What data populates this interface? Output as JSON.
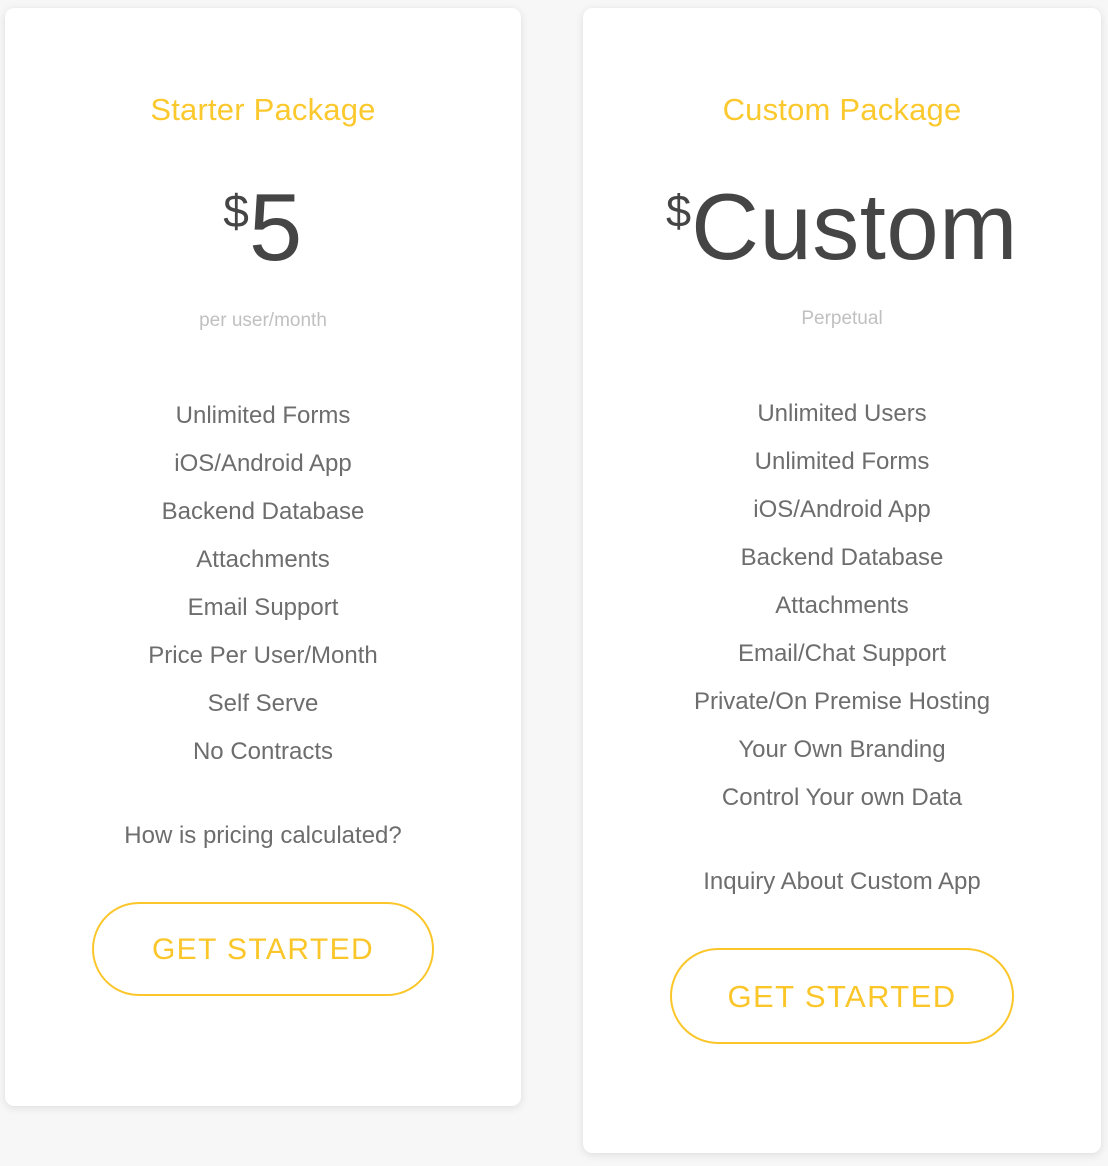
{
  "background_color": "#f7f7f7",
  "accent_color": "#fbc62a",
  "plans": [
    {
      "id": "starter",
      "title": "Starter Package",
      "price_currency": "$",
      "price_amount": "5",
      "price_period": "per user/month",
      "features": [
        "Unlimited Forms",
        "iOS/Android App",
        "Backend Database",
        "Attachments",
        "Email Support",
        "Price Per User/Month",
        "Self Serve",
        "No Contracts"
      ],
      "info_link": "How is pricing calculated?",
      "cta_label": "GET STARTED"
    },
    {
      "id": "custom",
      "title": "Custom Package",
      "price_currency": "$",
      "price_amount": "Custom",
      "price_period": "Perpetual",
      "features": [
        "Unlimited Users",
        "Unlimited Forms",
        "iOS/Android App",
        "Backend Database",
        "Attachments",
        "Email/Chat Support",
        "Private/On Premise Hosting",
        "Your Own Branding",
        "Control Your own Data"
      ],
      "info_link": "Inquiry About Custom App",
      "cta_label": "GET STARTED"
    }
  ]
}
